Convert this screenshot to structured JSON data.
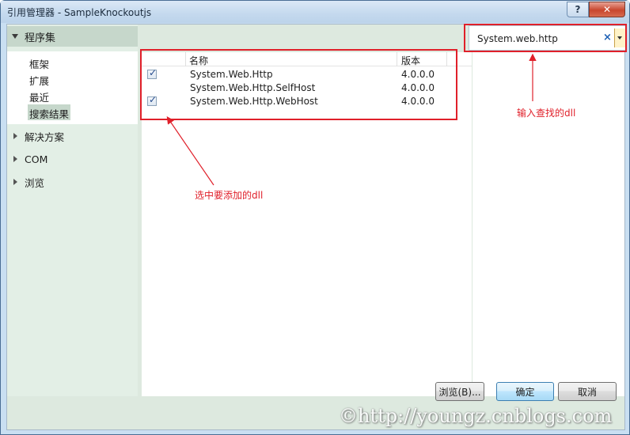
{
  "window": {
    "title": "引用管理器 - SampleKnockoutjs",
    "help_label": "?",
    "close_label": "✕"
  },
  "nav": {
    "header": "程序集",
    "sub_items": [
      {
        "label": "框架"
      },
      {
        "label": "扩展"
      },
      {
        "label": "最近"
      },
      {
        "label": "搜索结果",
        "selected": true
      }
    ],
    "groups": [
      {
        "label": "解决方案"
      },
      {
        "label": "COM"
      },
      {
        "label": "浏览"
      }
    ]
  },
  "search": {
    "value": "System.web.http",
    "clear_icon": "×"
  },
  "list": {
    "columns": {
      "name": "名称",
      "version": "版本"
    },
    "rows": [
      {
        "checked": true,
        "name": "System.Web.Http",
        "version": "4.0.0.0"
      },
      {
        "checked": false,
        "name": "System.Web.Http.SelfHost",
        "version": "4.0.0.0"
      },
      {
        "checked": true,
        "name": "System.Web.Http.WebHost",
        "version": "4.0.0.0"
      }
    ]
  },
  "buttons": {
    "browse": "浏览(B)...",
    "ok": "确定",
    "cancel": "取消"
  },
  "annotations": {
    "search_note": "输入查找的dll",
    "select_note": "选中要添加的dll",
    "color": "#e0202a"
  },
  "watermark": "©http://youngz.cnblogs.com"
}
